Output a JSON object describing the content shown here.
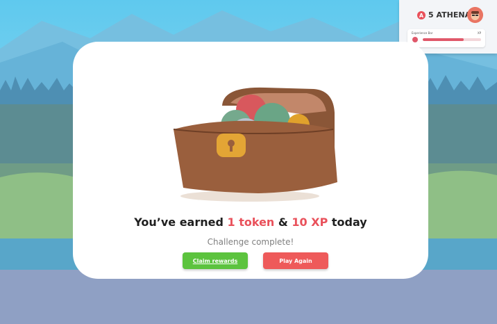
{
  "hud": {
    "badge_letter": "A",
    "user_label": "5 ATHENA",
    "xp_title": "Experience Bar",
    "xp_value": "XP",
    "xp_progress": 0.7,
    "colors": {
      "accent": "#e9515b",
      "panel": "#f3f5f8"
    }
  },
  "modal": {
    "earned_prefix": "You’ve earned",
    "earned_tokens": "1 token",
    "earned_amp": "&",
    "earned_xp": "10 XP",
    "earned_suffix": "today",
    "subtitle": "Challenge complete!",
    "claim_button": "Claim rewards",
    "play_button": "Play Again",
    "icons": [
      "treasure-chest-icon"
    ],
    "colors": {
      "claim": "#5cc33e",
      "play": "#ee5a5a",
      "accent": "#e9515b"
    }
  }
}
